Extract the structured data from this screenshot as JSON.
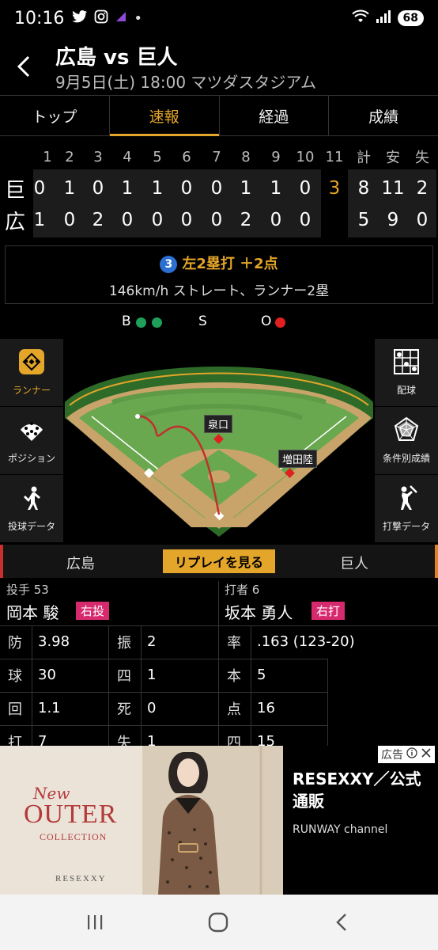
{
  "status_bar": {
    "time": "10:16",
    "battery": "68"
  },
  "header": {
    "title": "広島 vs 巨人",
    "subtitle": "9月5日(土) 18:00 マツダスタジアム"
  },
  "tabs": [
    {
      "label": "トップ"
    },
    {
      "label": "速報"
    },
    {
      "label": "経過"
    },
    {
      "label": "成績"
    }
  ],
  "scoreboard": {
    "innings": [
      "1",
      "2",
      "3",
      "4",
      "5",
      "6",
      "7",
      "8",
      "9",
      "10",
      "11"
    ],
    "totals_headers": [
      "計",
      "安",
      "失"
    ],
    "rows": [
      {
        "team": "巨",
        "scores": [
          "0",
          "1",
          "0",
          "1",
          "1",
          "0",
          "0",
          "1",
          "1",
          "0",
          "3"
        ],
        "totals": [
          "8",
          "11",
          "2"
        ]
      },
      {
        "team": "広",
        "scores": [
          "1",
          "0",
          "2",
          "0",
          "0",
          "0",
          "0",
          "2",
          "0",
          "0",
          ""
        ],
        "totals": [
          "5",
          "9",
          "0"
        ]
      }
    ]
  },
  "play": {
    "batter_no": "3",
    "result": "左2塁打 ＋2点",
    "detail": "146km/h ストレート、ランナー2塁"
  },
  "count": {
    "b_label": "B",
    "s_label": "S",
    "o_label": "O",
    "balls": 2,
    "strikes": 0,
    "outs": 1
  },
  "left_buttons": [
    {
      "label": "ランナー",
      "icon": "runner-diamond-icon"
    },
    {
      "label": "ポジション",
      "icon": "position-icon"
    },
    {
      "label": "投球データ",
      "icon": "pitcher-icon"
    }
  ],
  "right_buttons": [
    {
      "label": "配球",
      "icon": "pitch-grid-icon"
    },
    {
      "label": "条件別成績",
      "icon": "radar-chart-icon"
    },
    {
      "label": "打撃データ",
      "icon": "batter-icon"
    }
  ],
  "field": {
    "runner_labels": [
      "泉口",
      "増田陸"
    ]
  },
  "replay_bar": {
    "home_team": "広島",
    "button": "リプレイを見る",
    "away_team": "巨人"
  },
  "pitcher": {
    "role": "投手 53",
    "name": "岡本 駿",
    "hand": "右投",
    "stats": [
      {
        "k": "防",
        "v": "3.98"
      },
      {
        "k": "振",
        "v": "2"
      },
      {
        "k": "球",
        "v": "30"
      },
      {
        "k": "四",
        "v": "1"
      },
      {
        "k": "回",
        "v": "1.1"
      },
      {
        "k": "死",
        "v": "0"
      },
      {
        "k": "打",
        "v": "7"
      },
      {
        "k": "失",
        "v": "1"
      }
    ]
  },
  "batter": {
    "role": "打者 6",
    "name": "坂本 勇人",
    "hand": "右打",
    "stats": [
      {
        "k": "率",
        "v": ".163 (123-20)"
      },
      {
        "k": "本",
        "v": "5"
      },
      {
        "k": "点",
        "v": "16"
      },
      {
        "k": "四",
        "v": "15"
      }
    ]
  },
  "ad": {
    "label": "広告",
    "image_new": "New",
    "image_outer": "OUTER",
    "image_collection": "COLLECTION",
    "image_brand": "RESEXXY",
    "title": "RESEXXY／公式通販",
    "subtitle": "RUNWAY channel"
  },
  "colors": {
    "accent": "#e3a52a",
    "hand_badge": "#d72a6e",
    "ball_dot": "#1fa05a",
    "out_dot": "#e02020"
  }
}
